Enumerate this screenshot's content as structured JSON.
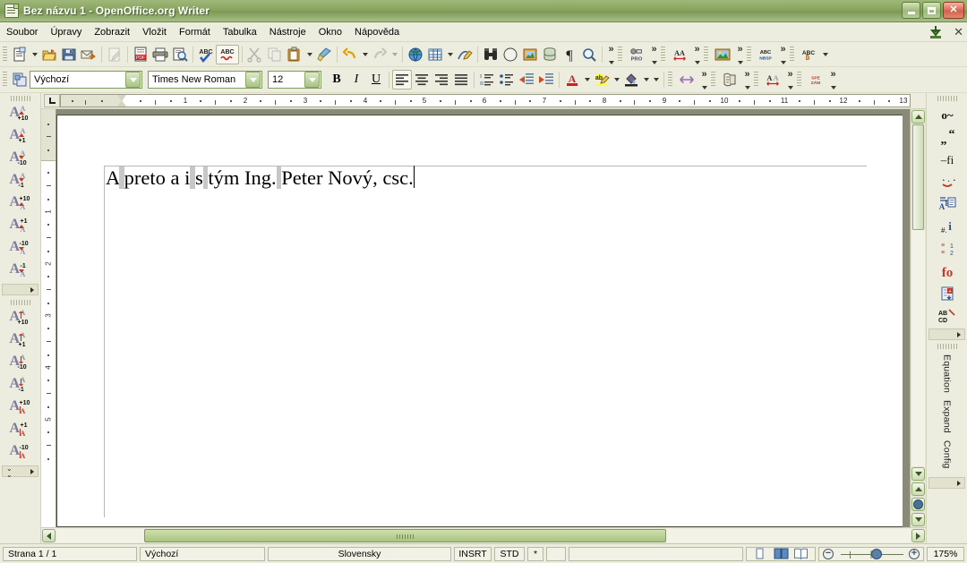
{
  "window": {
    "title": "Bez názvu 1 - OpenOffice.org Writer",
    "icon": "writer-document-icon",
    "minimize_label": "Minimalizovat",
    "maximize_label": "Maximalizovat",
    "close_label": "Zavřít"
  },
  "menubar": {
    "items": [
      {
        "label": "Soubor",
        "accel": "S"
      },
      {
        "label": "Úpravy",
        "accel": "Ú"
      },
      {
        "label": "Zobrazit",
        "accel": "Z"
      },
      {
        "label": "Vložit",
        "accel": "l"
      },
      {
        "label": "Formát",
        "accel": "F"
      },
      {
        "label": "Tabulka",
        "accel": "T"
      },
      {
        "label": "Nástroje",
        "accel": "N"
      },
      {
        "label": "Okno",
        "accel": "O"
      },
      {
        "label": "Nápověda",
        "accel": "ě"
      }
    ],
    "right_icons": [
      "download-green-arrow-icon",
      "close-document-icon"
    ]
  },
  "standard_toolbar": {
    "buttons": [
      {
        "name": "new-document",
        "icon": "new-doc-icon",
        "enabled": true,
        "dropdown": true
      },
      {
        "name": "open",
        "icon": "open-folder-icon",
        "enabled": true
      },
      {
        "name": "save",
        "icon": "floppy-save-icon",
        "enabled": true
      },
      {
        "name": "email-document",
        "icon": "envelope-arrow-icon",
        "enabled": true
      },
      {
        "name": "edit-file",
        "icon": "edit-pencil-page-icon",
        "enabled": false
      },
      {
        "name": "export-pdf",
        "icon": "pdf-page-icon",
        "enabled": true
      },
      {
        "name": "print",
        "icon": "printer-icon",
        "enabled": true
      },
      {
        "name": "page-preview",
        "icon": "magnifier-page-icon",
        "enabled": true
      },
      {
        "name": "spelling",
        "icon": "abc-check-icon",
        "enabled": true
      },
      {
        "name": "autospellcheck",
        "icon": "abc-underline-icon",
        "enabled": true,
        "active": true
      },
      {
        "name": "cut",
        "icon": "scissors-icon",
        "enabled": false
      },
      {
        "name": "copy",
        "icon": "copy-pages-icon",
        "enabled": false
      },
      {
        "name": "paste",
        "icon": "clipboard-icon",
        "enabled": true,
        "dropdown": true
      },
      {
        "name": "clone-formatting",
        "icon": "paintbrush-icon",
        "enabled": true
      },
      {
        "name": "undo",
        "icon": "undo-arrow-icon",
        "enabled": true,
        "dropdown": true
      },
      {
        "name": "redo",
        "icon": "redo-arrow-icon",
        "enabled": false,
        "dropdown": true
      },
      {
        "name": "hyperlink",
        "icon": "globe-icon",
        "enabled": true
      },
      {
        "name": "table",
        "icon": "table-grid-icon",
        "enabled": true,
        "dropdown": true
      },
      {
        "name": "show-draw-functions",
        "icon": "pencil-shapes-icon",
        "enabled": true
      },
      {
        "name": "find-replace",
        "icon": "binoculars-icon",
        "enabled": true
      },
      {
        "name": "navigator",
        "icon": "compass-icon",
        "enabled": true
      },
      {
        "name": "gallery",
        "icon": "picture-frame-icon",
        "enabled": true
      },
      {
        "name": "data-sources",
        "icon": "database-icon",
        "enabled": true
      },
      {
        "name": "formatting-marks",
        "icon": "pilcrow-icon",
        "enabled": true
      },
      {
        "name": "zoom",
        "icon": "magnifier-icon",
        "enabled": true
      }
    ],
    "extensions": [
      {
        "name": "pro-tools",
        "icon": "pro-icon",
        "label": "PRO"
      },
      {
        "name": "char-spacing",
        "icon": "aa-arrow-icon"
      },
      {
        "name": "image-tool",
        "icon": "landscape-image-icon"
      },
      {
        "name": "nbsp-tool",
        "icon": "abc-nbsp-icon",
        "label": "NBSP"
      },
      {
        "name": "abc-hand-tool",
        "icon": "abc-hand-icon"
      }
    ]
  },
  "formatting_toolbar": {
    "paragraph_style_icon": "paragraph-style-icon",
    "style": {
      "value": "Výchozí",
      "name": "paragraph-style-combo"
    },
    "font": {
      "value": "Times New Roman",
      "name": "font-name-combo"
    },
    "size": {
      "value": "12",
      "name": "font-size-combo"
    },
    "buttons": [
      {
        "name": "bold",
        "glyph": "B",
        "active": false
      },
      {
        "name": "italic",
        "glyph": "I",
        "active": false
      },
      {
        "name": "underline",
        "glyph": "U",
        "active": false
      },
      {
        "name": "align-left",
        "icon": "align-left-icon",
        "active": true
      },
      {
        "name": "align-center",
        "icon": "align-center-icon",
        "active": false
      },
      {
        "name": "align-right",
        "icon": "align-right-icon",
        "active": false
      },
      {
        "name": "align-justified",
        "icon": "align-justify-icon",
        "active": false
      },
      {
        "name": "ordered-list",
        "icon": "numbered-list-icon",
        "active": false
      },
      {
        "name": "unordered-list",
        "icon": "bullet-list-icon",
        "active": false
      },
      {
        "name": "decrease-indent",
        "icon": "decrease-indent-icon",
        "active": false
      },
      {
        "name": "increase-indent",
        "icon": "increase-indent-icon",
        "active": false
      },
      {
        "name": "font-color",
        "icon": "font-color-icon",
        "swatch": "#c00000",
        "dropdown": true
      },
      {
        "name": "highlighting",
        "icon": "highlight-icon",
        "swatch": "#ffff00",
        "dropdown": true
      },
      {
        "name": "background-color",
        "icon": "background-color-icon",
        "dropdown": true
      }
    ],
    "extensions": [
      {
        "name": "expand-arrows-tool",
        "icon": "left-right-arrow-icon"
      },
      {
        "name": "script-tool",
        "icon": "scroll-icon"
      },
      {
        "name": "aa-size-tool",
        "icon": "aa-resize-icon"
      },
      {
        "name": "spe-zam-tool",
        "icon": "spe-zam-icon",
        "label": "SPE ZÁM"
      }
    ]
  },
  "left_toolbar": {
    "name": "font-size-tools-toolbar",
    "group1": [
      {
        "name": "increase-font-10-upper",
        "num": "+10"
      },
      {
        "name": "increase-font-1-upper",
        "num": "+1"
      },
      {
        "name": "decrease-font-10-upper",
        "num": "-10"
      },
      {
        "name": "decrease-font-1-upper",
        "num": "-1"
      },
      {
        "name": "increase-font-10-lower",
        "num": "+10"
      },
      {
        "name": "increase-font-1-lower",
        "num": "+1"
      },
      {
        "name": "decrease-font-10-lower",
        "num": "-10"
      },
      {
        "name": "decrease-font-1-lower",
        "num": "-1"
      }
    ],
    "group2": [
      {
        "name": "increase-spacing-10",
        "num": "+10"
      },
      {
        "name": "increase-spacing-1",
        "num": "+1"
      },
      {
        "name": "decrease-spacing-10",
        "num": "-10"
      },
      {
        "name": "decrease-spacing-1",
        "num": "-1"
      },
      {
        "name": "raise-baseline-10",
        "num": "+10"
      },
      {
        "name": "raise-baseline-1",
        "num": "+1"
      },
      {
        "name": "lower-baseline-10",
        "num": "-10"
      }
    ]
  },
  "right_toolbar": {
    "name": "typography-tools-toolbar",
    "buttons": [
      {
        "name": "tilde-tool",
        "icon": "o-tilde-icon"
      },
      {
        "name": "quotes-tool",
        "icon": "quotation-marks-icon"
      },
      {
        "name": "ligature-tool",
        "icon": "fi-ligature-icon"
      },
      {
        "name": "accents-tool",
        "icon": "accent-marks-icon"
      },
      {
        "name": "sort-ab-tool",
        "icon": "sort-a-b-icon"
      },
      {
        "name": "number-info-tool",
        "icon": "number-info-icon"
      },
      {
        "name": "line-numbering-tool",
        "icon": "line-numbering-icon"
      },
      {
        "name": "fo-tool",
        "icon": "fo-red-icon"
      },
      {
        "name": "page-insert-tool",
        "icon": "page-insert-icon"
      },
      {
        "name": "abcd-tool",
        "icon": "ab-cd-icon"
      }
    ],
    "tabs": [
      {
        "name": "equation-tab",
        "label": "Equation"
      },
      {
        "name": "expand-tab",
        "label": "Expand"
      },
      {
        "name": "config-tab",
        "label": "Config"
      }
    ]
  },
  "ruler": {
    "horizontal_ticks": [
      "1",
      "2",
      "3",
      "4",
      "5",
      "6",
      "7",
      "8",
      "9",
      "10",
      "11",
      "12",
      "13"
    ],
    "vertical_ticks": [
      "1",
      "2",
      "3",
      "4",
      "5"
    ],
    "tab_stop_type": "tab-left-icon"
  },
  "document": {
    "segments": [
      {
        "text": "A",
        "nbsp": false
      },
      {
        "text": " ",
        "nbsp": true
      },
      {
        "text": "preto a i",
        "nbsp": false
      },
      {
        "text": " ",
        "nbsp": true
      },
      {
        "text": "s",
        "nbsp": false
      },
      {
        "text": " ",
        "nbsp": true
      },
      {
        "text": "tým Ing.",
        "nbsp": false
      },
      {
        "text": " ",
        "nbsp": true
      },
      {
        "text": "Peter Nový, csc.",
        "nbsp": false
      }
    ],
    "plain_text": "A preto a i s tým Ing. Peter Nový, csc."
  },
  "statusbar": {
    "page": "Strana 1 / 1",
    "style": "Výchozí",
    "language": "Slovensky",
    "insert_mode": "INSRT",
    "selection_mode": "STD",
    "modified": "*",
    "signature": "",
    "info": "",
    "view_modes": [
      {
        "name": "single-page-view",
        "icon": "single-page-icon",
        "active": false
      },
      {
        "name": "multi-page-view",
        "icon": "multi-page-icon",
        "active": true
      },
      {
        "name": "book-view",
        "icon": "book-view-icon",
        "active": false
      }
    ],
    "zoom_out_label": "−",
    "zoom_in_label": "+",
    "zoom": "175%"
  }
}
